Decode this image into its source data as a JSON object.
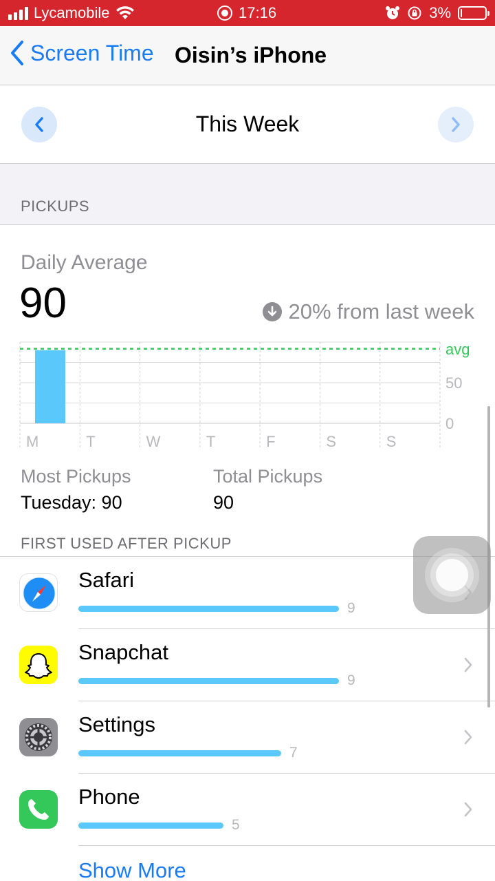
{
  "status_bar": {
    "carrier": "Lycamobile",
    "time": "17:16",
    "battery": "3%"
  },
  "nav": {
    "back_label": "Screen Time",
    "title": "Oisin’s iPhone"
  },
  "week_selector": {
    "label": "This Week"
  },
  "pickups": {
    "section_header": "PICKUPS",
    "daily_average_label": "Daily Average",
    "daily_average_value": "90",
    "trend_text": "20% from last week",
    "most_pickups_label": "Most Pickups",
    "most_pickups_value": "Tuesday: 90",
    "total_pickups_label": "Total Pickups",
    "total_pickups_value": "90"
  },
  "chart_data": {
    "type": "bar",
    "categories": [
      "M",
      "T",
      "W",
      "T",
      "F",
      "S",
      "S"
    ],
    "values": [
      90,
      0,
      0,
      0,
      0,
      0,
      0
    ],
    "ylim": [
      0,
      100
    ],
    "yticks": [
      "50",
      "0"
    ],
    "avg_label": "avg",
    "avg_value": 90,
    "colors": {
      "bar": "#5ac8fa",
      "avg": "#34c759"
    }
  },
  "first_used": {
    "section_header": "FIRST USED AFTER PICKUP",
    "apps": [
      {
        "name": "Safari",
        "count": "9",
        "value": 9,
        "icon": "safari-icon"
      },
      {
        "name": "Snapchat",
        "count": "9",
        "value": 9,
        "icon": "snapchat-icon"
      },
      {
        "name": "Settings",
        "count": "7",
        "value": 7,
        "icon": "settings-icon"
      },
      {
        "name": "Phone",
        "count": "5",
        "value": 5,
        "icon": "phone-icon"
      }
    ],
    "show_more": "Show More"
  },
  "colors": {
    "status_bar": "#d5262e",
    "accent": "#1a7cf5",
    "bar": "#5ac8fa"
  }
}
